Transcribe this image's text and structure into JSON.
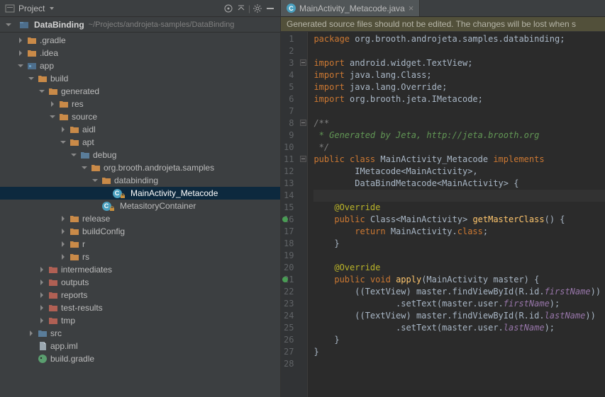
{
  "toolbar": {
    "project_label": "Project"
  },
  "breadcrumb": {
    "name": "DataBinding",
    "path": "~/Projects/androjeta-samples/DataBinding"
  },
  "tree": [
    {
      "d": 1,
      "a": "r",
      "t": "folder",
      "cls": "folder-icon",
      "label": ".gradle"
    },
    {
      "d": 1,
      "a": "r",
      "t": "folder",
      "cls": "folder-icon",
      "label": ".idea"
    },
    {
      "d": 1,
      "a": "d",
      "t": "module",
      "cls": "folder-blue",
      "label": "app"
    },
    {
      "d": 2,
      "a": "d",
      "t": "folder",
      "cls": "folder-icon",
      "label": "build"
    },
    {
      "d": 3,
      "a": "d",
      "t": "folder",
      "cls": "folder-icon",
      "label": "generated"
    },
    {
      "d": 4,
      "a": "r",
      "t": "folder",
      "cls": "folder-icon",
      "label": "res"
    },
    {
      "d": 4,
      "a": "d",
      "t": "folder",
      "cls": "folder-icon",
      "label": "source"
    },
    {
      "d": 5,
      "a": "r",
      "t": "folder",
      "cls": "folder-icon",
      "label": "aidl"
    },
    {
      "d": 5,
      "a": "d",
      "t": "folder",
      "cls": "folder-icon",
      "label": "apt"
    },
    {
      "d": 6,
      "a": "d",
      "t": "folder",
      "cls": "folder-blue",
      "label": "debug"
    },
    {
      "d": 7,
      "a": "d",
      "t": "folder",
      "cls": "folder-icon",
      "label": "org.brooth.androjeta.samples"
    },
    {
      "d": 8,
      "a": "d",
      "t": "folder",
      "cls": "folder-icon",
      "label": "databinding"
    },
    {
      "d": 9,
      "a": "",
      "t": "class",
      "label": "MainActivity_Metacode",
      "sel": true,
      "lock": true
    },
    {
      "d": 8,
      "a": "",
      "t": "class",
      "label": "MetasitoryContainer",
      "lock": true
    },
    {
      "d": 5,
      "a": "r",
      "t": "folder",
      "cls": "folder-icon",
      "label": "release"
    },
    {
      "d": 5,
      "a": "r",
      "t": "folder",
      "cls": "folder-icon",
      "label": "buildConfig"
    },
    {
      "d": 5,
      "a": "r",
      "t": "folder",
      "cls": "folder-icon",
      "label": "r"
    },
    {
      "d": 5,
      "a": "r",
      "t": "folder",
      "cls": "folder-icon",
      "label": "rs"
    },
    {
      "d": 3,
      "a": "r",
      "t": "folder",
      "cls": "folder-red",
      "label": "intermediates"
    },
    {
      "d": 3,
      "a": "r",
      "t": "folder",
      "cls": "folder-red",
      "label": "outputs"
    },
    {
      "d": 3,
      "a": "r",
      "t": "folder",
      "cls": "folder-red",
      "label": "reports"
    },
    {
      "d": 3,
      "a": "r",
      "t": "folder",
      "cls": "folder-red",
      "label": "test-results"
    },
    {
      "d": 3,
      "a": "r",
      "t": "folder",
      "cls": "folder-red",
      "label": "tmp"
    },
    {
      "d": 2,
      "a": "r",
      "t": "folder",
      "cls": "folder-blue",
      "label": "src"
    },
    {
      "d": 2,
      "a": "",
      "t": "file",
      "label": "app.iml"
    },
    {
      "d": 2,
      "a": "",
      "t": "gradle",
      "label": "build.gradle"
    }
  ],
  "editor": {
    "tab_label": "MainActivity_Metacode.java",
    "warning": "Generated source files should not be edited. The changes will be lost when s",
    "lines": [
      [
        [
          "kw",
          "package "
        ],
        [
          "cls",
          "org.brooth.androjeta.samples.databinding;"
        ]
      ],
      [],
      [
        [
          "kw",
          "import "
        ],
        [
          "cls",
          "android.widget.TextView;"
        ]
      ],
      [
        [
          "kw",
          "import "
        ],
        [
          "cls",
          "java.lang.Class;"
        ]
      ],
      [
        [
          "kw",
          "import "
        ],
        [
          "cls",
          "java.lang.Override;"
        ]
      ],
      [
        [
          "kw",
          "import "
        ],
        [
          "cls",
          "org.brooth.jeta.IMetacode;"
        ]
      ],
      [],
      [
        [
          "com",
          "/**"
        ]
      ],
      [
        [
          "com2",
          " * Generated by Jeta, http://jeta.brooth.org"
        ]
      ],
      [
        [
          "com",
          " */"
        ]
      ],
      [
        [
          "kw",
          "public class "
        ],
        [
          "cls",
          "MainActivity_Metacode "
        ],
        [
          "kw",
          "implements"
        ]
      ],
      [
        [
          "cls",
          "        IMetacode<MainActivity>,"
        ]
      ],
      [
        [
          "cls",
          "        DataBindMetacode<MainActivity> {"
        ]
      ],
      [],
      [
        [
          "cls",
          "    "
        ],
        [
          "ann",
          "@Override"
        ]
      ],
      [
        [
          "cls",
          "    "
        ],
        [
          "kw",
          "public "
        ],
        [
          "cls",
          "Class<MainActivity> "
        ],
        [
          "mth",
          "getMasterClass"
        ],
        [
          "cls",
          "() {"
        ]
      ],
      [
        [
          "cls",
          "        "
        ],
        [
          "kw",
          "return "
        ],
        [
          "cls",
          "MainActivity."
        ],
        [
          "kw",
          "class"
        ],
        [
          "cls",
          ";"
        ]
      ],
      [
        [
          "cls",
          "    }"
        ]
      ],
      [],
      [
        [
          "cls",
          "    "
        ],
        [
          "ann",
          "@Override"
        ]
      ],
      [
        [
          "cls",
          "    "
        ],
        [
          "kw",
          "public void "
        ],
        [
          "mth",
          "apply"
        ],
        [
          "cls",
          "(MainActivity master) {"
        ]
      ],
      [
        [
          "cls",
          "        ((TextView) master.findViewById(R.id."
        ],
        [
          "fld",
          "firstName"
        ],
        [
          "cls",
          "))"
        ]
      ],
      [
        [
          "cls",
          "                .setText(master.user."
        ],
        [
          "fld",
          "firstName"
        ],
        [
          "cls",
          ");"
        ]
      ],
      [
        [
          "cls",
          "        ((TextView) master.findViewById(R.id."
        ],
        [
          "fld",
          "lastName"
        ],
        [
          "cls",
          "))"
        ]
      ],
      [
        [
          "cls",
          "                .setText(master.user."
        ],
        [
          "fld",
          "lastName"
        ],
        [
          "cls",
          ");"
        ]
      ],
      [
        [
          "cls",
          "    }"
        ]
      ],
      [
        [
          "cls",
          "}"
        ]
      ],
      []
    ],
    "markers": {
      "16": true,
      "21": true
    },
    "folds": [
      3,
      8,
      11
    ]
  }
}
